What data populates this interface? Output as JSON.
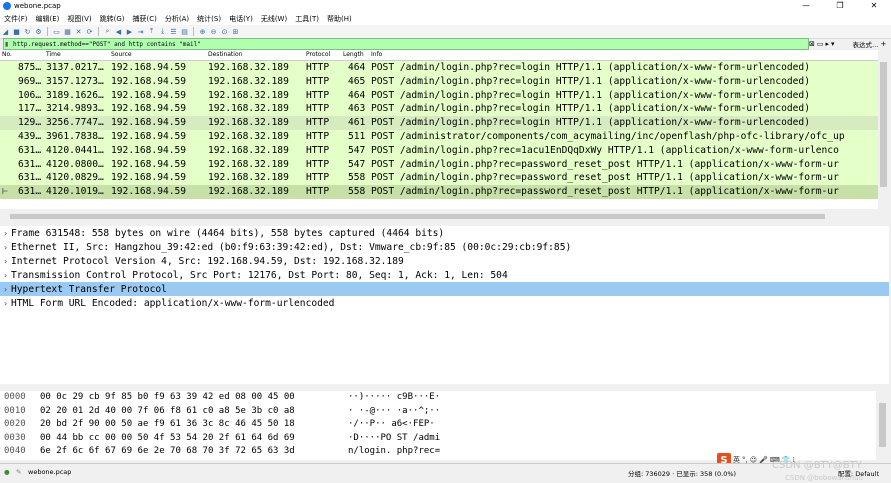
{
  "window": {
    "title": "webone.pcap",
    "controls": [
      "—",
      "❐",
      "✕"
    ]
  },
  "menu": [
    "文件(F)",
    "编辑(E)",
    "视图(V)",
    "跳转(G)",
    "捕获(C)",
    "分析(A)",
    "统计(S)",
    "电话(Y)",
    "无线(W)",
    "工具(T)",
    "帮助(H)"
  ],
  "filter": {
    "value": "http.request.method==\"POST\" and http contains \"mail\"",
    "expression_label": "表达式…",
    "plus_label": "+"
  },
  "columns": [
    "No.",
    "Time",
    "Source",
    "Destination",
    "Protocol",
    "Length",
    "Info"
  ],
  "packets": [
    {
      "no": "875…",
      "time": "3137.0217…",
      "src": "192.168.94.59",
      "dst": "192.168.32.189",
      "proto": "HTTP",
      "len": "464",
      "info": "POST /admin/login.php?rec=login HTTP/1.1  (application/x-www-form-urlencoded)"
    },
    {
      "no": "969…",
      "time": "3157.1273…",
      "src": "192.168.94.59",
      "dst": "192.168.32.189",
      "proto": "HTTP",
      "len": "465",
      "info": "POST /admin/login.php?rec=login HTTP/1.1  (application/x-www-form-urlencoded)"
    },
    {
      "no": "106…",
      "time": "3189.1626…",
      "src": "192.168.94.59",
      "dst": "192.168.32.189",
      "proto": "HTTP",
      "len": "464",
      "info": "POST /admin/login.php?rec=login HTTP/1.1  (application/x-www-form-urlencoded)"
    },
    {
      "no": "117…",
      "time": "3214.9893…",
      "src": "192.168.94.59",
      "dst": "192.168.32.189",
      "proto": "HTTP",
      "len": "463",
      "info": "POST /admin/login.php?rec=login HTTP/1.1  (application/x-www-form-urlencoded)"
    },
    {
      "no": "129…",
      "time": "3256.7747…",
      "src": "192.168.94.59",
      "dst": "192.168.32.189",
      "proto": "HTTP",
      "len": "461",
      "info": "POST /admin/login.php?rec=login HTTP/1.1  (application/x-www-form-urlencoded)"
    },
    {
      "no": "439…",
      "time": "3961.7838…",
      "src": "192.168.94.59",
      "dst": "192.168.32.189",
      "proto": "HTTP",
      "len": "511",
      "info": "POST /administrator/components/com_acymailing/inc/openflash/php-ofc-library/ofc_up"
    },
    {
      "no": "631…",
      "time": "4120.0441…",
      "src": "192.168.94.59",
      "dst": "192.168.32.189",
      "proto": "HTTP",
      "len": "547",
      "info": "POST /admin/login.php?rec=1acu1EnDQqDxWy HTTP/1.1  (application/x-www-form-urlenco"
    },
    {
      "no": "631…",
      "time": "4120.0800…",
      "src": "192.168.94.59",
      "dst": "192.168.32.189",
      "proto": "HTTP",
      "len": "547",
      "info": "POST /admin/login.php?rec=password_reset_post HTTP/1.1  (application/x-www-form-ur"
    },
    {
      "no": "631…",
      "time": "4120.0829…",
      "src": "192.168.94.59",
      "dst": "192.168.32.189",
      "proto": "HTTP",
      "len": "558",
      "info": "POST /admin/login.php?rec=password_reset_post HTTP/1.1  (application/x-www-form-ur"
    },
    {
      "no": "631…",
      "time": "4120.1019…",
      "src": "192.168.94.59",
      "dst": "192.168.32.189",
      "proto": "HTTP",
      "len": "558",
      "info": "POST /admin/login.php?rec=password_reset_post HTTP/1.1  (application/x-www-form-ur"
    }
  ],
  "details": [
    "Frame 631548: 558 bytes on wire (4464 bits), 558 bytes captured (4464 bits)",
    "Ethernet II, Src: Hangzhou_39:42:ed (b0:f9:63:39:42:ed), Dst: Vmware_cb:9f:85 (00:0c:29:cb:9f:85)",
    "Internet Protocol Version 4, Src: 192.168.94.59, Dst: 192.168.32.189",
    "Transmission Control Protocol, Src Port: 12176, Dst Port: 80, Seq: 1, Ack: 1, Len: 504",
    "Hypertext Transfer Protocol",
    "HTML Form URL Encoded: application/x-www-form-urlencoded"
  ],
  "bytes": [
    {
      "off": "0000",
      "hex": "00 0c 29 cb 9f 85 b0 f9  63 39 42 ed 08 00 45 00",
      "ascii": "··)····· c9B···E·"
    },
    {
      "off": "0010",
      "hex": "02 20 01 2d 40 00 7f 06  f8 61 c0 a8 5e 3b c0 a8",
      "ascii": "· ·-@··· ·a··^;··"
    },
    {
      "off": "0020",
      "hex": "20 bd 2f 90 00 50 ae f9  61 36 3c 8c 46 45 50 18",
      "ascii": " ·/··P·· a6<·FEP·"
    },
    {
      "off": "0030",
      "hex": "00 44 bb cc 00 00 50 4f  53 54 20 2f 61 64 6d 69",
      "ascii": "·D····PO ST /admi"
    },
    {
      "off": "0040",
      "hex": "6e 2f 6c 6f 67 69 6e 2e  70 68 70 3f 72 65 63 3d",
      "ascii": "n/login. php?rec="
    }
  ],
  "status": {
    "file": "webone.pcap",
    "packets": "分组: 736029 · 已显示: 358 (0.0%)",
    "profile": "配置: Default"
  },
  "ime": {
    "logo": "S",
    "label": "英"
  },
  "watermark": {
    "main": "CSDN @BTY@BTY",
    "sub": "CSDN @bobowanshuo"
  }
}
